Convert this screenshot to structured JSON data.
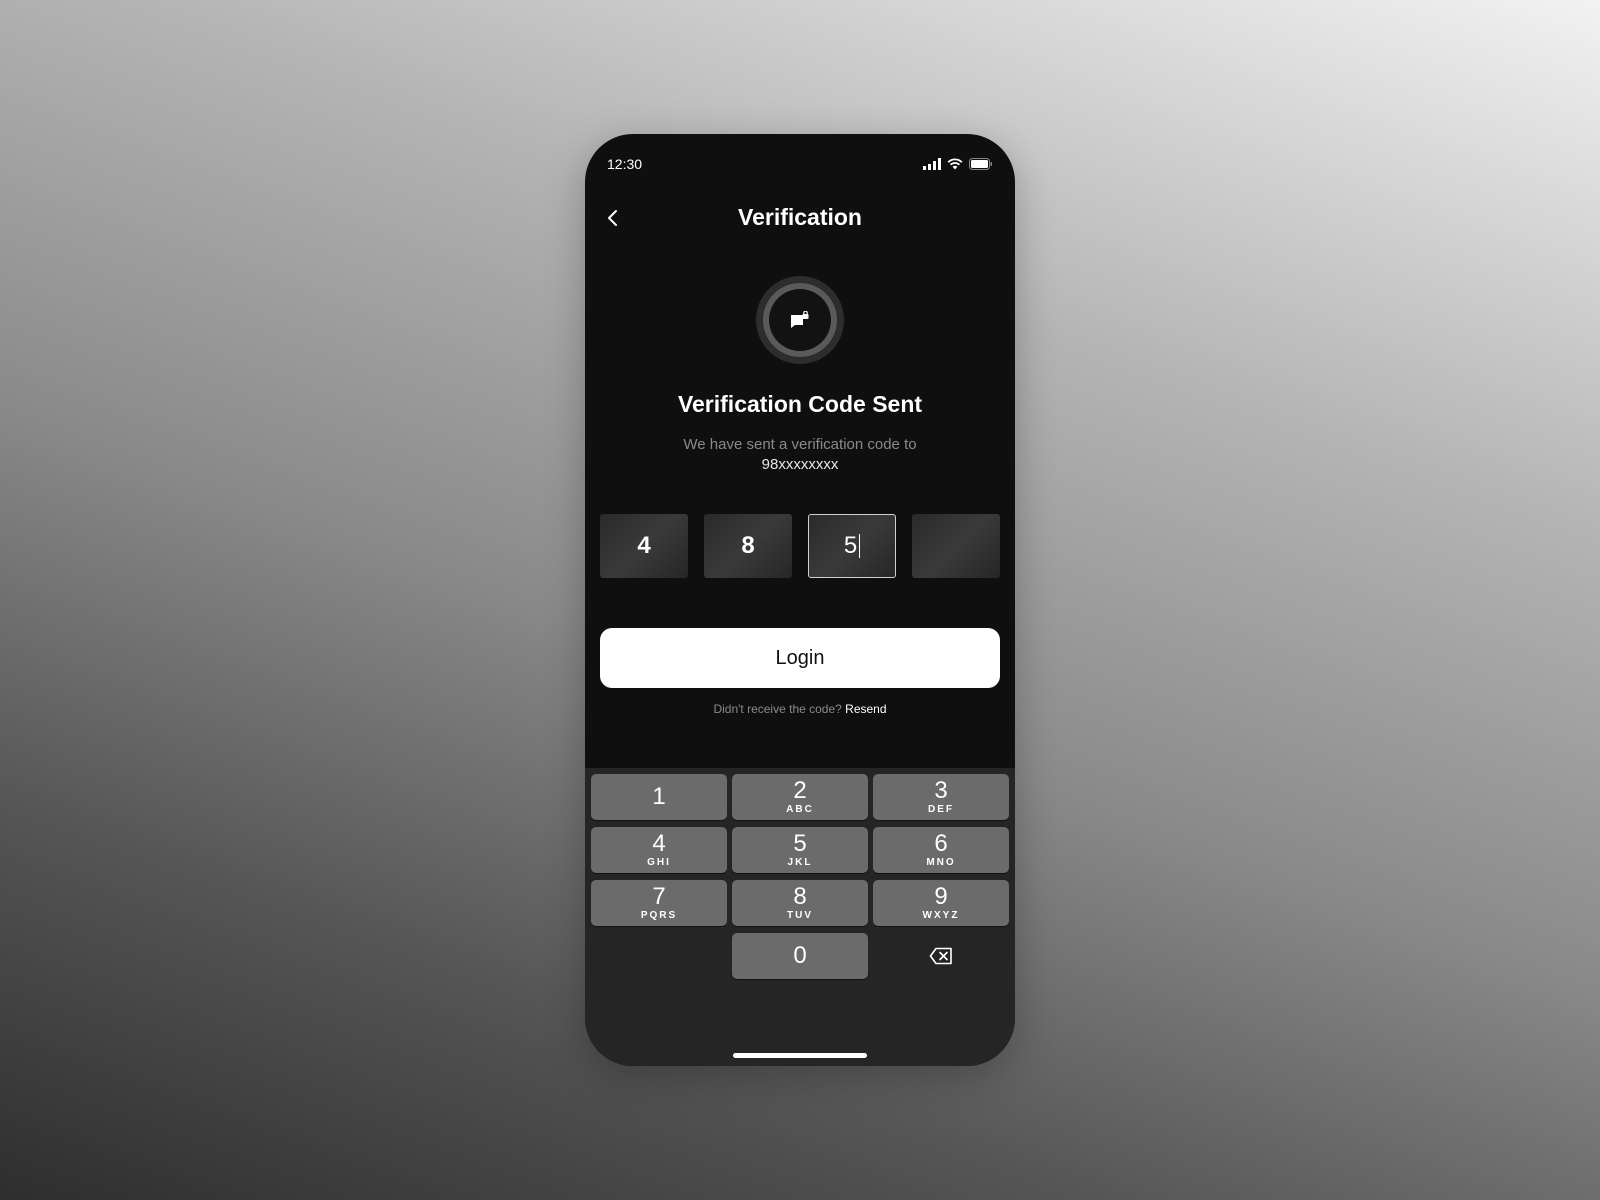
{
  "status_bar": {
    "time": "12:30"
  },
  "header": {
    "title": "Verification"
  },
  "hero": {
    "headline": "Verification Code Sent",
    "subtitle": "We have sent a verification code to",
    "phone_number": "98xxxxxxxx"
  },
  "otp": {
    "digits": [
      "4",
      "8",
      "5",
      ""
    ],
    "active_index": 2
  },
  "login_button": {
    "label": "Login"
  },
  "resend": {
    "prompt": "Didn't receive the code?",
    "link": "Resend"
  },
  "keypad": {
    "keys": [
      {
        "digit": "1",
        "letters": ""
      },
      {
        "digit": "2",
        "letters": "ABC"
      },
      {
        "digit": "3",
        "letters": "DEF"
      },
      {
        "digit": "4",
        "letters": "GHI"
      },
      {
        "digit": "5",
        "letters": "JKL"
      },
      {
        "digit": "6",
        "letters": "MNO"
      },
      {
        "digit": "7",
        "letters": "PQRS"
      },
      {
        "digit": "8",
        "letters": "TUV"
      },
      {
        "digit": "9",
        "letters": "WXYZ"
      },
      {
        "digit": "0",
        "letters": ""
      }
    ]
  },
  "colors": {
    "screen_bg": "#0f0f0f",
    "keypad_bg": "#252525",
    "key_bg": "#6b6b6b",
    "accent_button": "#ffffff"
  },
  "icons": [
    "back-chevron-icon",
    "signal-icon",
    "wifi-icon",
    "battery-icon",
    "message-lock-icon",
    "backspace-icon"
  ]
}
